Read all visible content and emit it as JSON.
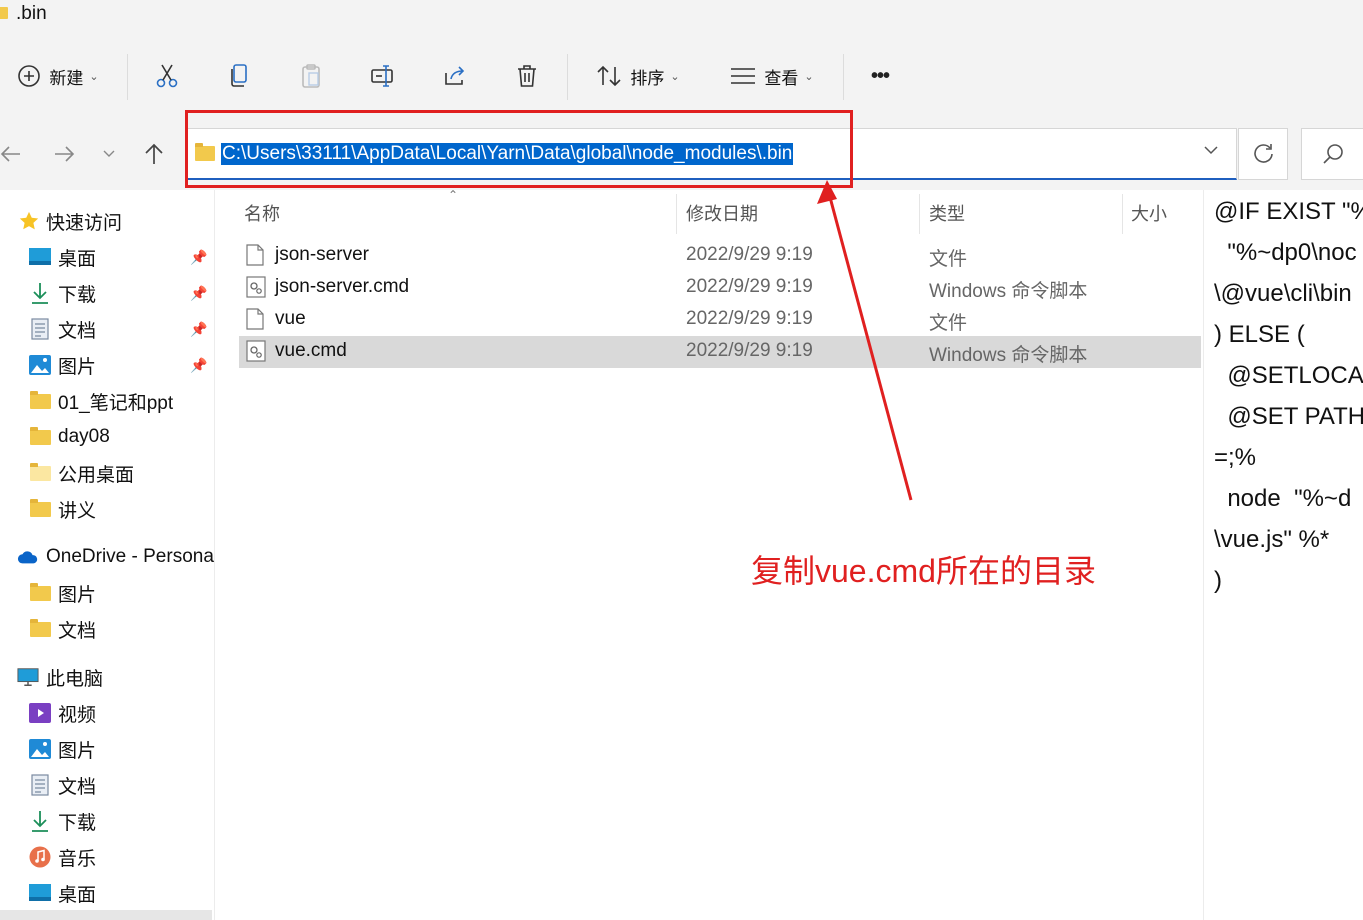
{
  "window": {
    "title": ".bin"
  },
  "toolbar": {
    "new_label": "新建",
    "sort_label": "排序",
    "view_label": "查看",
    "more": "•••"
  },
  "address": {
    "path": "C:\\Users\\33111\\AppData\\Local\\Yarn\\Data\\global\\node_modules\\.bin"
  },
  "sidebar": {
    "quick_access": "快速访问",
    "items": [
      {
        "label": "桌面",
        "icon": "desktop-icon",
        "pinned": true
      },
      {
        "label": "下载",
        "icon": "download-icon",
        "pinned": true
      },
      {
        "label": "文档",
        "icon": "document-icon",
        "pinned": true
      },
      {
        "label": "图片",
        "icon": "pictures-icon",
        "pinned": true
      },
      {
        "label": "01_笔记和ppt",
        "icon": "folder-icon"
      },
      {
        "label": "day08",
        "icon": "folder-icon"
      },
      {
        "label": "公用桌面",
        "icon": "folder-icon"
      },
      {
        "label": "讲义",
        "icon": "folder-icon"
      }
    ],
    "onedrive": "OneDrive - Persona",
    "onedrive_items": [
      {
        "label": "图片",
        "icon": "folder-icon"
      },
      {
        "label": "文档",
        "icon": "folder-icon"
      }
    ],
    "this_pc": "此电脑",
    "pc_items": [
      {
        "label": "视频",
        "icon": "video-icon"
      },
      {
        "label": "图片",
        "icon": "pictures-icon"
      },
      {
        "label": "文档",
        "icon": "document-icon"
      },
      {
        "label": "下载",
        "icon": "download-icon"
      },
      {
        "label": "音乐",
        "icon": "music-icon"
      },
      {
        "label": "桌面",
        "icon": "desktop-icon"
      }
    ]
  },
  "file_list": {
    "columns": [
      "名称",
      "修改日期",
      "类型",
      "大小"
    ],
    "rows": [
      {
        "name": "json-server",
        "date": "2022/9/29 9:19",
        "type": "文件",
        "icon": "file-icon"
      },
      {
        "name": "json-server.cmd",
        "date": "2022/9/29 9:19",
        "type": "Windows 命令脚本",
        "icon": "cmd-file-icon"
      },
      {
        "name": "vue",
        "date": "2022/9/29 9:19",
        "type": "文件",
        "icon": "file-icon"
      },
      {
        "name": "vue.cmd",
        "date": "2022/9/29 9:19",
        "type": "Windows 命令脚本",
        "icon": "cmd-file-icon",
        "selected": true
      }
    ]
  },
  "preview": {
    "lines": [
      "@IF EXIST \"%",
      "  \"%~dp0\\noc",
      "\\@vue\\cli\\bin",
      ") ELSE (",
      "  @SETLOCAL",
      "  @SET PATH",
      "=;%",
      "  node  \"%~d",
      "\\vue.js\" %*",
      ")"
    ]
  },
  "annotation": {
    "text": "复制vue.cmd所在的目录",
    "color": "#e02020"
  },
  "colors": {
    "selection": "#0066cc",
    "accent": "#1f5fbf",
    "folder": "#f2c94c"
  }
}
